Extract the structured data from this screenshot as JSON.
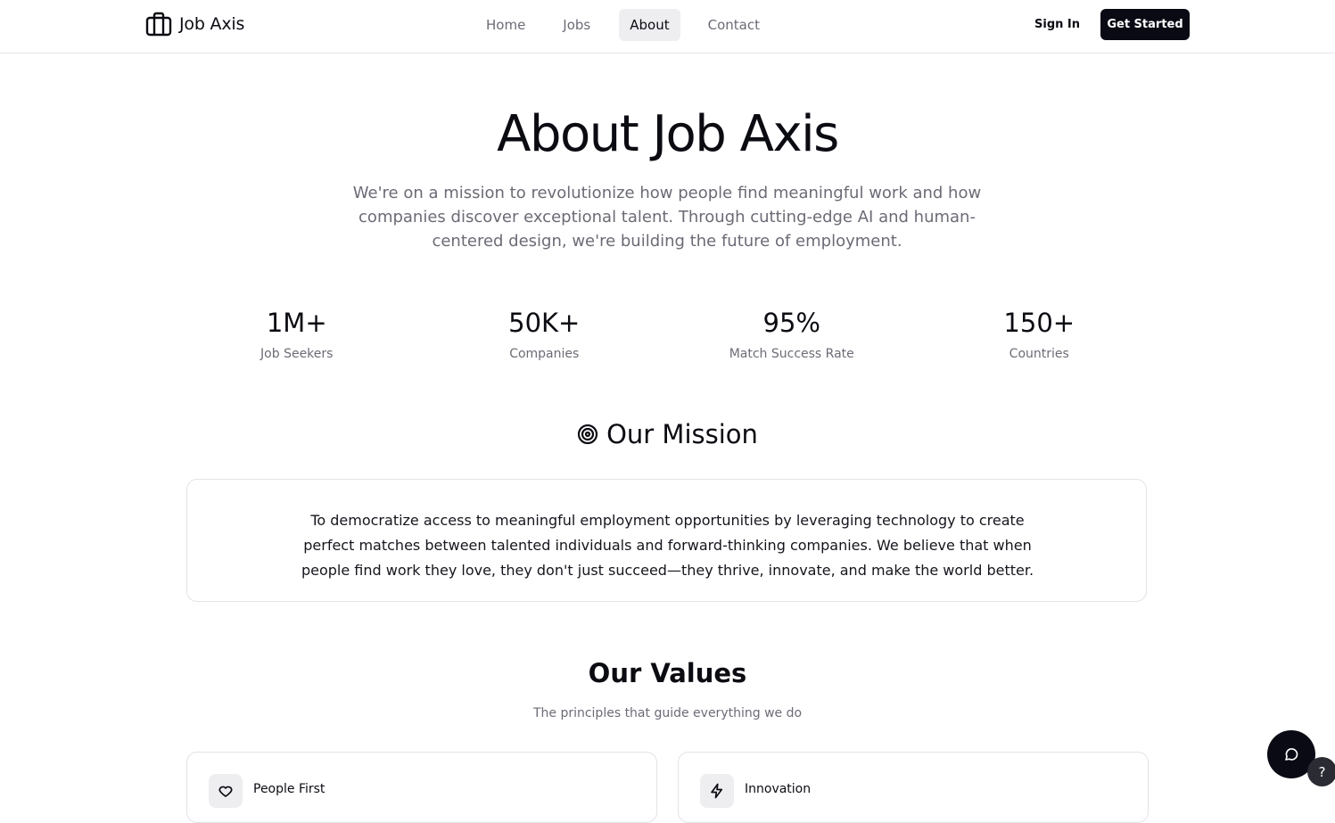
{
  "nav": {
    "brand": "Job Axis",
    "links": [
      {
        "label": "Home",
        "active": false
      },
      {
        "label": "Jobs",
        "active": false
      },
      {
        "label": "About",
        "active": true
      },
      {
        "label": "Contact",
        "active": false
      }
    ],
    "sign_in": "Sign In",
    "get_started": "Get Started"
  },
  "hero": {
    "title": "About Job Axis",
    "subtitle": "We're on a mission to revolutionize how people find meaningful work and how companies discover exceptional talent. Through cutting-edge AI and human-centered design, we're building the future of employment."
  },
  "stats": [
    {
      "value": "1M+",
      "label": "Job Seekers"
    },
    {
      "value": "50K+",
      "label": "Companies"
    },
    {
      "value": "95%",
      "label": "Match Success Rate"
    },
    {
      "value": "150+",
      "label": "Countries"
    }
  ],
  "mission": {
    "heading": "Our Mission",
    "icon": "target-icon",
    "text": "To democratize access to meaningful employment opportunities by leveraging technology to create perfect matches between talented individuals and forward-thinking companies. We believe that when people find work they love, they don't just succeed—they thrive, innovate, and make the world better."
  },
  "values": {
    "heading": "Our Values",
    "subtitle": "The principles that guide everything we do",
    "cards": [
      {
        "title": "People First",
        "icon": "heart-icon"
      },
      {
        "title": "Innovation",
        "icon": "lightning-icon"
      }
    ]
  },
  "widgets": {
    "chat_icon": "chat-bubble-icon",
    "help_label": "?"
  },
  "colors": {
    "primary": "#0a0a14",
    "muted_text": "#6b6b76",
    "border": "#e3e3e8",
    "active_nav_bg": "#eeeef1"
  }
}
